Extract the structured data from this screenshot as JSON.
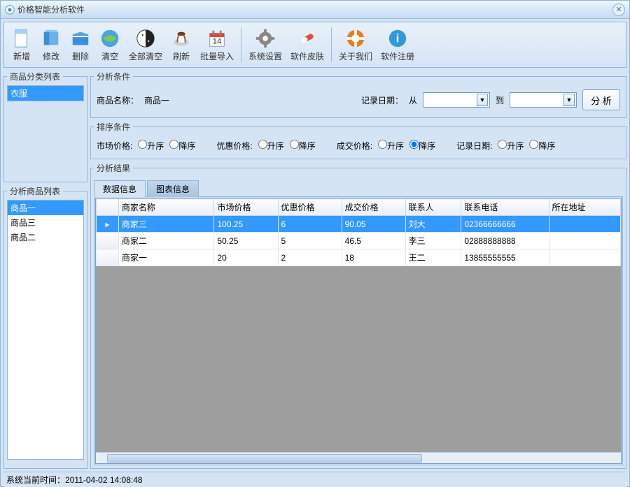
{
  "window": {
    "title": "价格智能分析软件"
  },
  "toolbar": {
    "items": [
      {
        "label": "新增",
        "icon": "new"
      },
      {
        "label": "修改",
        "icon": "edit"
      },
      {
        "label": "删除",
        "icon": "delete"
      },
      {
        "label": "清空",
        "icon": "clear"
      },
      {
        "label": "全部清空",
        "icon": "clearall"
      },
      {
        "label": "刷新",
        "icon": "refresh"
      },
      {
        "label": "批量导入",
        "icon": "import"
      }
    ],
    "items2": [
      {
        "label": "系统设置",
        "icon": "settings"
      },
      {
        "label": "软件皮肤",
        "icon": "skin"
      }
    ],
    "items3": [
      {
        "label": "关于我们",
        "icon": "about"
      },
      {
        "label": "软件注册",
        "icon": "register"
      }
    ]
  },
  "left": {
    "category_title": "商品分类列表",
    "category_items": [
      "衣服"
    ],
    "category_selected": 0,
    "product_title": "分析商品列表",
    "product_items": [
      "商品一",
      "商品三",
      "商品二"
    ],
    "product_selected": 0
  },
  "cond": {
    "title": "分析条件",
    "name_label": "商品名称：",
    "name_value": "商品一",
    "date_label": "记录日期：",
    "from_label": "从",
    "to_label": "到",
    "analyze_label": "分 析",
    "from_value": "",
    "to_value": ""
  },
  "sort": {
    "title": "排序条件",
    "groups": [
      {
        "label": "市场价格:",
        "opts": [
          "升序",
          "降序"
        ],
        "sel": -1
      },
      {
        "label": "优惠价格:",
        "opts": [
          "升序",
          "降序"
        ],
        "sel": -1
      },
      {
        "label": "成交价格:",
        "opts": [
          "升序",
          "降序"
        ],
        "sel": 1
      },
      {
        "label": "记录日期:",
        "opts": [
          "升序",
          "降序"
        ],
        "sel": -1
      }
    ]
  },
  "result": {
    "title": "分析结果",
    "tabs": [
      "数据信息",
      "图表信息"
    ],
    "active_tab": 0,
    "columns": [
      "商家名称",
      "市场价格",
      "优惠价格",
      "成交价格",
      "联系人",
      "联系电话",
      "所在地址"
    ],
    "rows": [
      {
        "sel": true,
        "cells": [
          "商家三",
          "100.25",
          "6",
          "90.05",
          "刘大",
          "02366666666",
          ""
        ]
      },
      {
        "sel": false,
        "cells": [
          "商家二",
          "50.25",
          "5",
          "46.5",
          "李三",
          "02888888888",
          ""
        ]
      },
      {
        "sel": false,
        "cells": [
          "商家一",
          "20",
          "2",
          "18",
          "王二",
          "13855555555",
          ""
        ]
      }
    ]
  },
  "status": {
    "label": "系统当前时间：",
    "value": "2011-04-02 14:08:48"
  }
}
